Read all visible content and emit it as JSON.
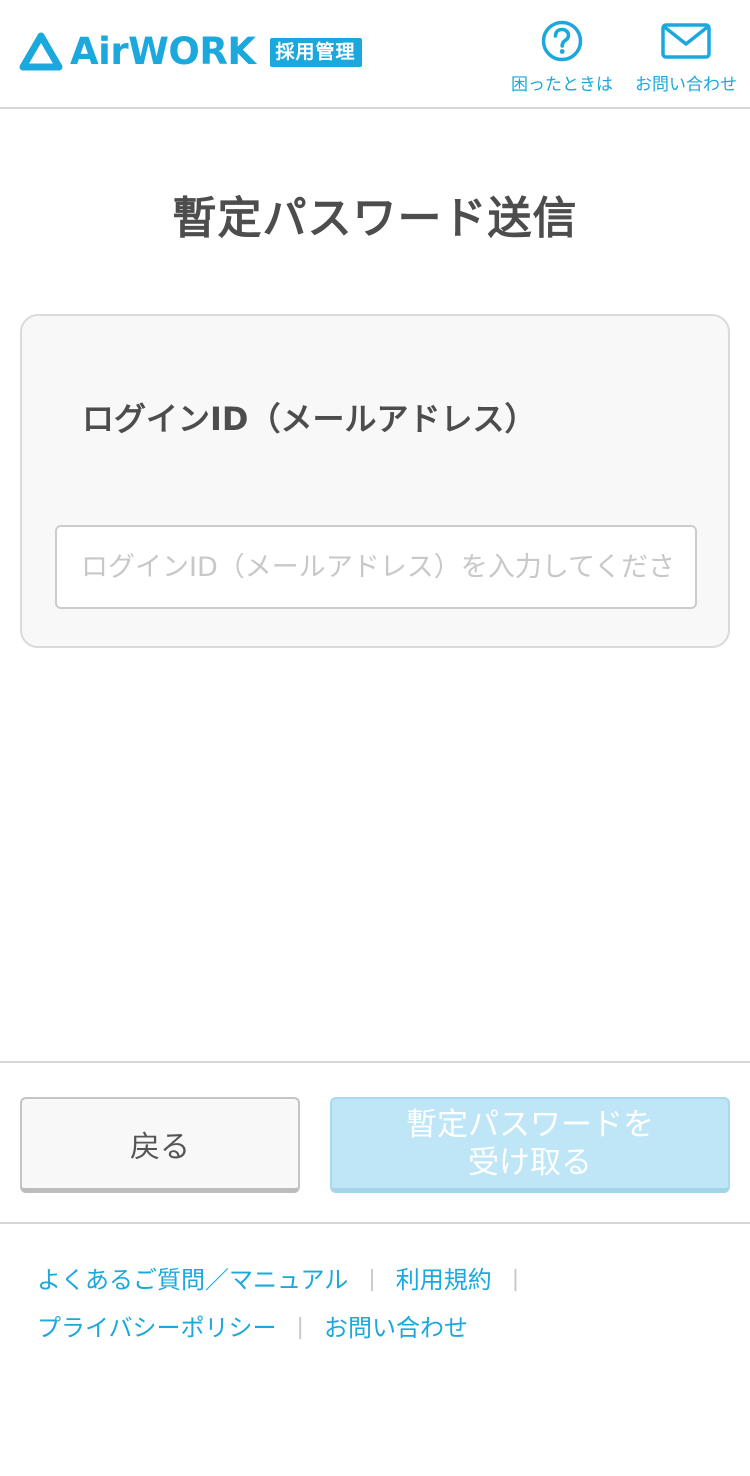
{
  "header": {
    "logo_text": "AirWORK",
    "logo_badge": "採用管理",
    "help_label": "困ったときは",
    "contact_label": "お問い合わせ",
    "help_icon": "question-circle-icon",
    "contact_icon": "envelope-icon"
  },
  "main": {
    "title": "暫定パスワード送信",
    "field_label": "ログインID（メールアドレス）",
    "input_value": "",
    "input_placeholder": "ログインID（メールアドレス）を入力してください"
  },
  "actions": {
    "back_label": "戻る",
    "submit_line1": "暫定パスワードを",
    "submit_line2": "受け取る"
  },
  "footer": {
    "faq_label": "よくあるご質問／マニュアル",
    "terms_label": "利用規約",
    "privacy_label": "プライバシーポリシー",
    "contact_label": "お問い合わせ",
    "separator": "|"
  },
  "colors": {
    "brand": "#1ba8dd",
    "disabled_button": "#bfe6f6",
    "text": "#4d4d4d"
  }
}
